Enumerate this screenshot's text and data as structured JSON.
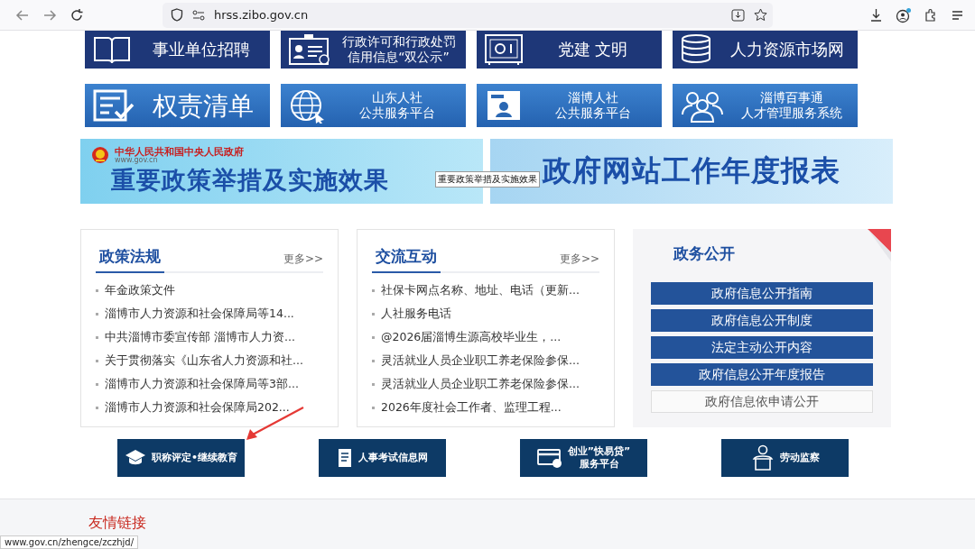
{
  "browser": {
    "url": "hrss.zibo.gov.cn"
  },
  "banners_row1": [
    {
      "lines": [
        "事业单位招聘"
      ]
    },
    {
      "lines": [
        "行政许可和行政处罚",
        "信用信息“双公示”"
      ]
    },
    {
      "lines": [
        "党建 文明"
      ]
    },
    {
      "lines": [
        "人力资源市场网"
      ]
    }
  ],
  "banners_row2": [
    {
      "lines": [
        "权责清单"
      ]
    },
    {
      "lines": [
        "山东人社",
        "公共服务平台"
      ]
    },
    {
      "lines": [
        "淄博人社",
        "公共服务平台"
      ]
    },
    {
      "lines": [
        "淄博百事通",
        "人才管理服务系统"
      ]
    }
  ],
  "feature_banners": [
    {
      "site_name": "中华人民共和国中央人民政府",
      "site_url": "www.gov.cn",
      "title": "重要政策举措及实施效果"
    },
    {
      "title": "政府网站工作年度报表"
    }
  ],
  "tooltip": "重要政策举措及实施效果",
  "news_panels": [
    {
      "title": "政策法规",
      "more": "更多>>",
      "items": [
        "年金政策文件",
        "淄博市人力资源和社会保障局等14...",
        "中共淄博市委宣传部 淄博市人力资...",
        "关于贯彻落实《山东省人力资源和社...",
        "淄博市人力资源和社会保障局等3部...",
        "淄博市人力资源和社会保障局202..."
      ]
    },
    {
      "title": "交流互动",
      "more": "更多>>",
      "items": [
        "社保卡网点名称、地址、电话（更新...",
        "人社服务电话",
        "@2026届淄博生源高校毕业生，...",
        "灵活就业人员企业职工养老保险参保...",
        "灵活就业人员企业职工养老保险参保...",
        "2026年度社会工作者、监理工程..."
      ]
    }
  ],
  "open_panel": {
    "title": "政务公开",
    "links": [
      {
        "label": "政府信息公开指南",
        "kind": "primary"
      },
      {
        "label": "政府信息公开制度",
        "kind": "primary"
      },
      {
        "label": "法定主动公开内容",
        "kind": "primary"
      },
      {
        "label": "政府信息公开年度报告",
        "kind": "primary"
      },
      {
        "label": "政府信息依申请公开",
        "kind": "plain"
      }
    ]
  },
  "service_buttons": [
    {
      "lines": [
        "职称评定•继续教育"
      ]
    },
    {
      "lines": [
        "人事考试信息网"
      ]
    },
    {
      "lines": [
        "创业”快易贷”",
        "服务平台"
      ]
    },
    {
      "lines": [
        "劳动监察"
      ]
    }
  ],
  "footer": {
    "title": "友情链接"
  },
  "status_url": "www.gov.cn/zhengce/zczhjd/"
}
